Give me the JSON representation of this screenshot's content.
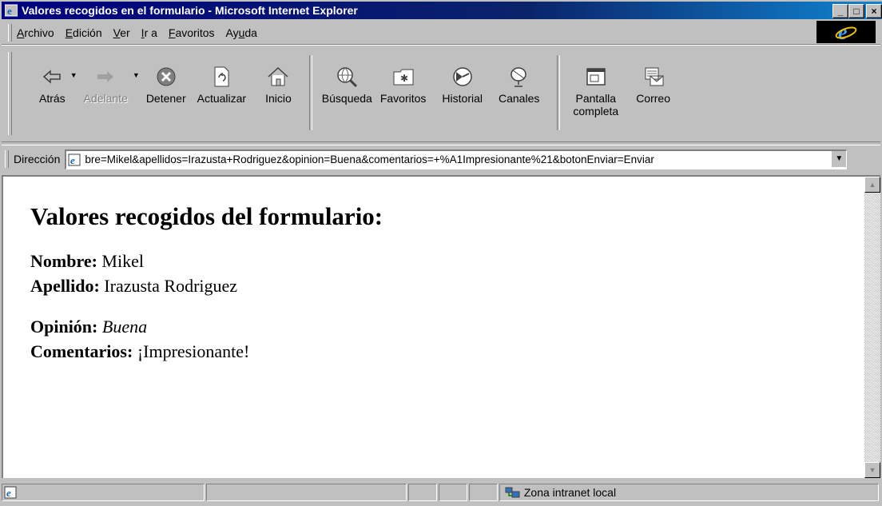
{
  "window": {
    "title": "Valores recogidos en el formulario - Microsoft Internet Explorer",
    "caption_buttons": [
      "_",
      "□",
      "×"
    ]
  },
  "menubar": {
    "items": [
      {
        "pre": "",
        "u": "A",
        "post": "rchivo"
      },
      {
        "pre": "",
        "u": "E",
        "post": "dición"
      },
      {
        "pre": "",
        "u": "V",
        "post": "er"
      },
      {
        "pre": "",
        "u": "I",
        "post": "r a"
      },
      {
        "pre": "",
        "u": "F",
        "post": "avoritos"
      },
      {
        "pre": "Ay",
        "u": "u",
        "post": "da"
      }
    ]
  },
  "toolbar": {
    "back": "Atrás",
    "forward": "Adelante",
    "stop": "Detener",
    "refresh": "Actualizar",
    "home": "Inicio",
    "search": "Búsqueda",
    "favorites": "Favoritos",
    "history": "Historial",
    "channels": "Canales",
    "fullscreen_1": "Pantalla",
    "fullscreen_2": "completa",
    "mail": "Correo"
  },
  "address": {
    "label": "Dirección",
    "url": "bre=Mikel&apellidos=Irazusta+Rodriguez&opinion=Buena&comentarios=+%A1Impresionante%21&botonEnviar=Enviar"
  },
  "page": {
    "heading": "Valores recogidos del formulario:",
    "nombre_label": "Nombre:",
    "nombre_value": "Mikel",
    "apellido_label": "Apellido:",
    "apellido_value": "Irazusta Rodriguez",
    "opinion_label": "Opinión:",
    "opinion_value": "Buena",
    "comentarios_label": "Comentarios:",
    "comentarios_value": "¡Impresionante!"
  },
  "statusbar": {
    "zone": "Zona intranet local"
  }
}
